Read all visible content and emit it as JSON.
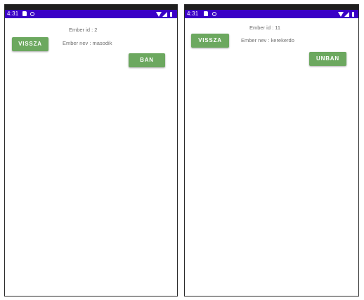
{
  "screens": [
    {
      "status": {
        "time": "4:31"
      },
      "ember_id": "Ember id : 2",
      "ember_nev": "Ember nev : masodik",
      "back_button": "VISSZA",
      "action_button": "BAN"
    },
    {
      "status": {
        "time": "4:31"
      },
      "ember_id": "Ember id : 11",
      "ember_nev": "Ember nev : kerekerdo",
      "back_button": "VISSZA",
      "action_button": "UNBAN"
    }
  ],
  "colors": {
    "status_bar": "#3a00c6",
    "button": "#6ca85f"
  },
  "icons": [
    "sd-card-icon",
    "sync-icon",
    "wifi-icon",
    "signal-icon",
    "battery-icon"
  ]
}
